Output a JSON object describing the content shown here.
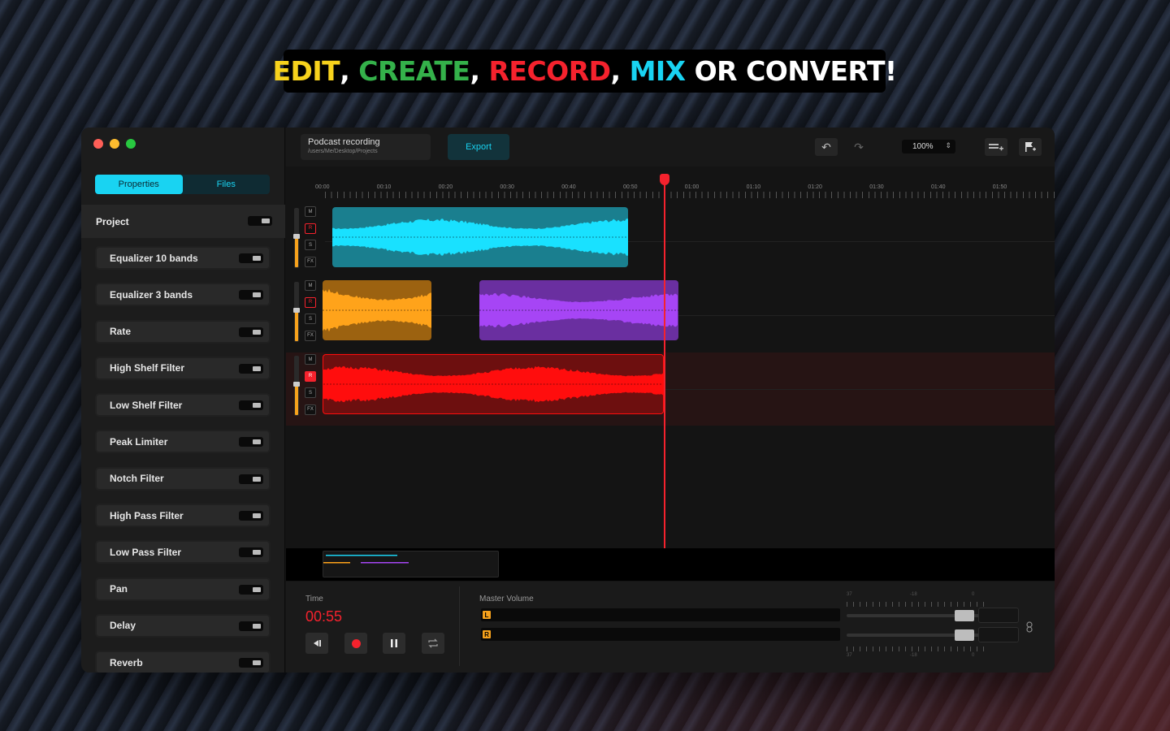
{
  "headline": {
    "w1": "EDIT",
    "sep1": ",",
    "w2": "CREATE",
    "sep2": ",",
    "w3": "RECORD",
    "sep3": ",",
    "w4": "MIX",
    "rest": "OR CONVERT!"
  },
  "sidebar": {
    "tabs": [
      "Properties",
      "Files"
    ],
    "active_tab": "Properties",
    "project_label": "Project",
    "effects": [
      "Equalizer 10 bands",
      "Equalizer 3 bands",
      "Rate",
      "High Shelf Filter",
      "Low Shelf Filter",
      "Peak Limiter",
      "Notch Filter",
      "High Pass Filter",
      "Low Pass Filter",
      "Pan",
      "Delay",
      "Reverb"
    ]
  },
  "toolbar": {
    "project_title": "Podcast recording",
    "project_path": "/users/Me/Desktop/Projects",
    "export_label": "Export",
    "zoom": "100%"
  },
  "ruler": {
    "labels": [
      "00:00",
      "00:10",
      "00:20",
      "00:30",
      "00:40",
      "00:50",
      "01:00",
      "01:10",
      "01:20",
      "01:30",
      "01:40",
      "01:50"
    ]
  },
  "tracks": [
    {
      "buttons": [
        "M",
        "R",
        "S",
        "FX"
      ],
      "record_armed": false,
      "clips": [
        {
          "color": "#19e1ff",
          "bg": "#1a7f8f"
        }
      ]
    },
    {
      "buttons": [
        "M",
        "R",
        "S",
        "FX"
      ],
      "record_armed": false,
      "clips": [
        {
          "color": "#ffa31a",
          "bg": "#9c6210"
        },
        {
          "color": "#a645f5",
          "bg": "#6a2fa0"
        }
      ]
    },
    {
      "buttons": [
        "M",
        "R",
        "S",
        "FX"
      ],
      "record_armed": true,
      "clips": [
        {
          "color": "#ff0d0d",
          "bg": "#6d0f0f"
        }
      ]
    }
  ],
  "transport": {
    "time_label": "Time",
    "time_value": "00:55",
    "master_label": "Master Volume",
    "left_channel": "L",
    "right_channel": "R",
    "scale_labels": [
      "37",
      "-18",
      "0"
    ]
  },
  "colors": {
    "accent": "#19d3f2",
    "record": "#f5222d",
    "edit": "#f7d21c",
    "create": "#34b14a",
    "mix": "#19d3f2"
  }
}
